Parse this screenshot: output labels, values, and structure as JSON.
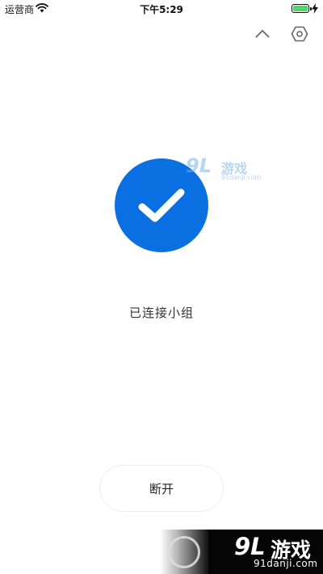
{
  "status_bar": {
    "carrier": "运营商",
    "time": "下午5:29",
    "battery_level": 1.0
  },
  "toolbar": {
    "collapse_icon": "chevron-up-icon",
    "settings_icon": "hexagon-gear-icon"
  },
  "connection": {
    "status_icon": "check-icon",
    "accent_color": "#0a6fe0",
    "status_text": "已连接小组",
    "disconnect_label": "断开"
  },
  "watermark": {
    "logo_number": "9L",
    "logo_text": "游戏",
    "domain": "91danji.com"
  }
}
